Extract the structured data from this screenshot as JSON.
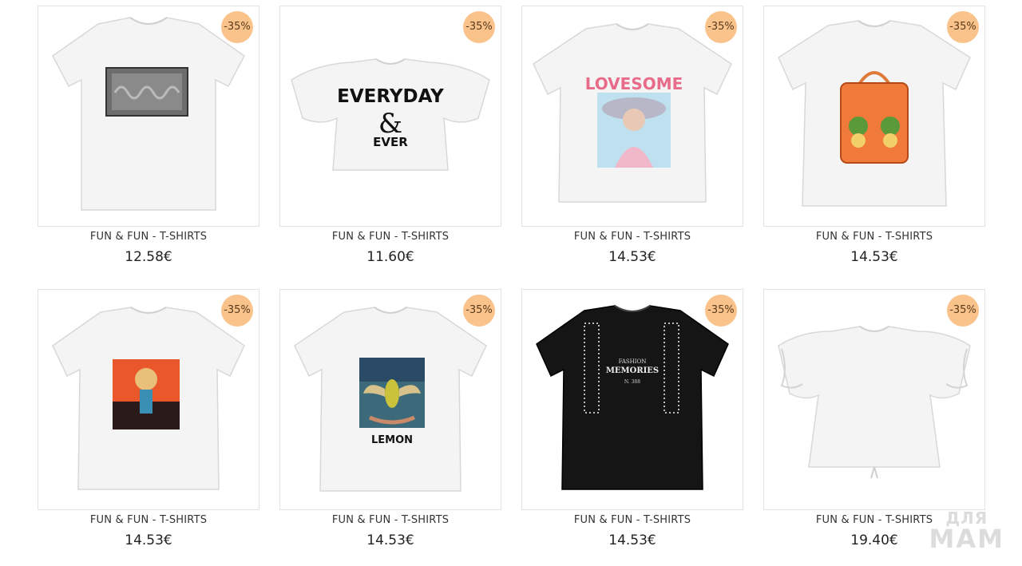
{
  "products": [
    {
      "brand": "FUN & FUN - T-SHIRTS",
      "price": "12.58€",
      "discount": "-35%",
      "shirt_color": "#f4f4f4",
      "print": "sequin-logo"
    },
    {
      "brand": "FUN & FUN - T-SHIRTS",
      "price": "11.60€",
      "discount": "-35%",
      "shirt_color": "#f4f4f4",
      "print": "text",
      "print_text": [
        "EVERYDAY",
        "&",
        "EVER"
      ]
    },
    {
      "brand": "FUN & FUN - T-SHIRTS",
      "price": "14.53€",
      "discount": "-35%",
      "shirt_color": "#f4f4f4",
      "print": "lovesome",
      "print_text": [
        "LOVESOME"
      ]
    },
    {
      "brand": "FUN & FUN - T-SHIRTS",
      "price": "14.53€",
      "discount": "-35%",
      "shirt_color": "#f4f4f4",
      "print": "handbag"
    },
    {
      "brand": "FUN & FUN - T-SHIRTS",
      "price": "14.53€",
      "discount": "-35%",
      "shirt_color": "#f4f4f4",
      "print": "girl"
    },
    {
      "brand": "FUN & FUN - T-SHIRTS",
      "price": "14.53€",
      "discount": "-35%",
      "shirt_color": "#f4f4f4",
      "print": "lemon",
      "print_text": [
        "LEMON"
      ]
    },
    {
      "brand": "FUN & FUN - T-SHIRTS",
      "price": "14.53€",
      "discount": "-35%",
      "shirt_color": "#151515",
      "print": "memories",
      "print_text": [
        "FASHION",
        "MEMORIES",
        "N. 388"
      ]
    },
    {
      "brand": "FUN & FUN - T-SHIRTS",
      "price": "19.40€",
      "discount": "-35%",
      "shirt_color": "#f4f4f4",
      "print": "ruffle"
    }
  ],
  "watermark": {
    "line1": "ДЛЯ",
    "line2": "МАМ"
  },
  "colors": {
    "badge": "#f9c38b",
    "border": "#e3e3e3"
  }
}
